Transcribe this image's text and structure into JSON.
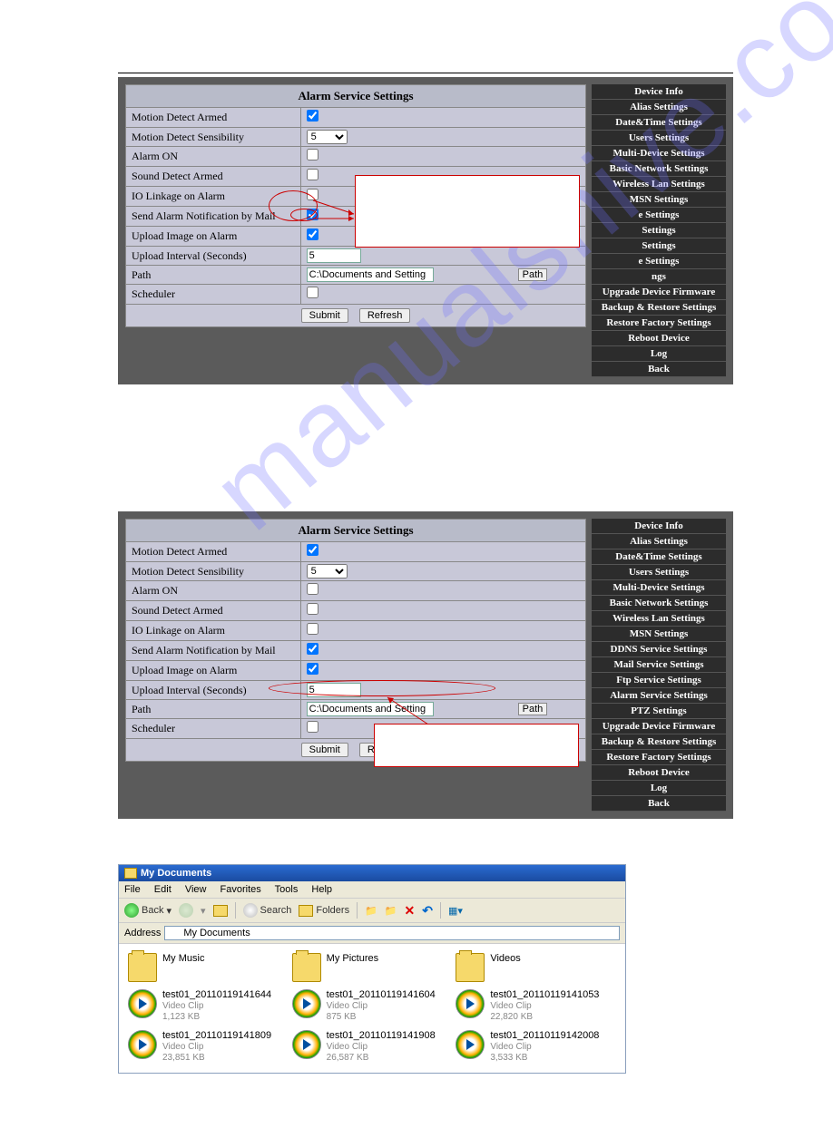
{
  "watermark": "manualshive.com",
  "panel1": {
    "title": "Alarm Service Settings",
    "rows": {
      "motion_detect_armed": "Motion Detect Armed",
      "motion_detect_sensibility": "Motion Detect Sensibility",
      "alarm_on": "Alarm ON",
      "sound_detect_armed": "Sound Detect Armed",
      "io_linkage": "IO Linkage on Alarm",
      "send_mail": "Send Alarm Notification by Mail",
      "upload_image": "Upload Image on Alarm",
      "upload_interval": "Upload Interval (Seconds)",
      "path": "Path",
      "scheduler": "Scheduler"
    },
    "values": {
      "motion_detect_armed": true,
      "sensibility": "5",
      "alarm_on": false,
      "sound_detect_armed": false,
      "io_linkage": false,
      "send_mail": true,
      "upload_image": true,
      "interval": "5",
      "path_value": "C:\\Documents and Setting",
      "scheduler": false
    },
    "path_btn": "Path",
    "submit": "Submit",
    "refresh": "Refresh"
  },
  "sidebar1": {
    "items": [
      "Device Info",
      "Alias Settings",
      "Date&Time Settings",
      "Users Settings",
      "Multi-Device Settings",
      "Basic Network Settings",
      "Wireless Lan Settings",
      "MSN Settings",
      "e Settings",
      "Settings",
      "Settings",
      "e Settings",
      "ngs",
      "Upgrade Device Firmware",
      "Backup & Restore Settings",
      "Restore Factory Settings",
      "Reboot Device",
      "Log",
      "Back"
    ]
  },
  "panel2": {
    "title": "Alarm Service Settings",
    "rows": {
      "motion_detect_armed": "Motion Detect Armed",
      "motion_detect_sensibility": "Motion Detect Sensibility",
      "alarm_on": "Alarm ON",
      "sound_detect_armed": "Sound Detect Armed",
      "io_linkage": "IO Linkage on Alarm",
      "send_mail": "Send Alarm Notification by Mail",
      "upload_image": "Upload Image on Alarm",
      "upload_interval": "Upload Interval (Seconds)",
      "path": "Path",
      "scheduler": "Scheduler"
    },
    "values": {
      "motion_detect_armed": true,
      "sensibility": "5",
      "alarm_on": false,
      "sound_detect_armed": false,
      "io_linkage": false,
      "send_mail": true,
      "upload_image": true,
      "interval": "5",
      "path_value": "C:\\Documents and Setting",
      "scheduler": false
    },
    "path_btn": "Path",
    "submit": "Submit",
    "refresh": "Refresh"
  },
  "sidebar2": {
    "items": [
      "Device Info",
      "Alias Settings",
      "Date&Time Settings",
      "Users Settings",
      "Multi-Device Settings",
      "Basic Network Settings",
      "Wireless Lan Settings",
      "MSN Settings",
      "DDNS Service Settings",
      "Mail Service Settings",
      "Ftp Service Settings",
      "Alarm Service Settings",
      "PTZ Settings",
      "Upgrade Device Firmware",
      "Backup & Restore Settings",
      "Restore Factory Settings",
      "Reboot Device",
      "Log",
      "Back"
    ]
  },
  "explorer": {
    "title": "My Documents",
    "menu": {
      "file": "File",
      "edit": "Edit",
      "view": "View",
      "favorites": "Favorites",
      "tools": "Tools",
      "help": "Help"
    },
    "toolbar": {
      "back": "Back",
      "search": "Search",
      "folders": "Folders"
    },
    "address_label": "Address",
    "address_value": "My Documents",
    "folders": [
      {
        "name": "My Music"
      },
      {
        "name": "My Pictures"
      },
      {
        "name": "Videos"
      }
    ],
    "files": [
      {
        "name": "test01_20110119141644",
        "type": "Video Clip",
        "size": "1,123 KB"
      },
      {
        "name": "test01_20110119141604",
        "type": "Video Clip",
        "size": "875 KB"
      },
      {
        "name": "test01_20110119141053",
        "type": "Video Clip",
        "size": "22,820 KB"
      },
      {
        "name": "test01_20110119141809",
        "type": "Video Clip",
        "size": "23,851 KB"
      },
      {
        "name": "test01_20110119141908",
        "type": "Video Clip",
        "size": "26,587 KB"
      },
      {
        "name": "test01_20110119142008",
        "type": "Video Clip",
        "size": "3,533 KB"
      }
    ]
  }
}
